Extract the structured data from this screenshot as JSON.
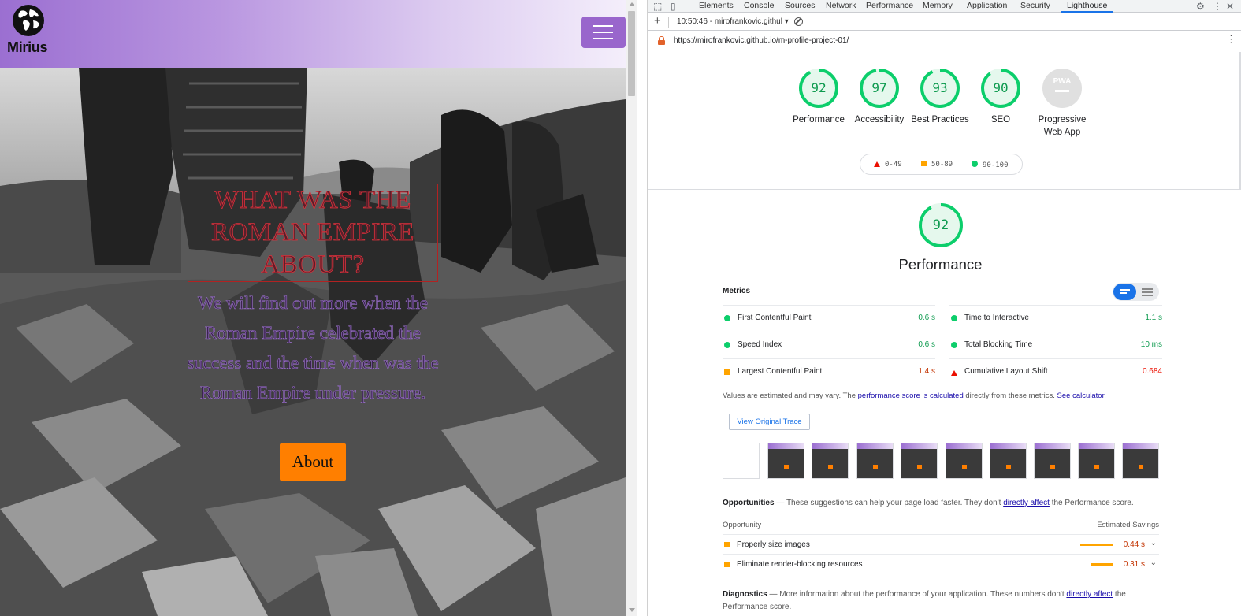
{
  "site": {
    "logo_text": "Mirius",
    "hero_title": "What was the Roman Empire about?",
    "hero_subtitle": "We will find out more when the Roman Empire celebrated the success and the time when was the Roman Empire under pressure.",
    "about_button": "About",
    "colors": {
      "header_start": "#9b6fd1",
      "burger": "#9966cc",
      "about": "#ff7f00",
      "title_stroke": "#d9323c"
    }
  },
  "devtools": {
    "tabs": [
      "Elements",
      "Console",
      "Sources",
      "Network",
      "Performance",
      "Memory",
      "Application",
      "Security",
      "Lighthouse"
    ],
    "active_tab": "Lighthouse",
    "report_select": "10:50:46 - mirofrankovic.githul ▾",
    "url": "https://mirofrankovic.github.io/m-profile-project-01/",
    "gauges": [
      {
        "score": "92",
        "label": "Performance",
        "value": 92
      },
      {
        "score": "97",
        "label": "Accessibility",
        "value": 97
      },
      {
        "score": "93",
        "label": "Best Practices",
        "value": 93
      },
      {
        "score": "90",
        "label": "SEO",
        "value": 90
      },
      {
        "score": "",
        "label": "Progressive Web App",
        "value": 0,
        "badge": "PWA"
      }
    ],
    "legend": {
      "fail": "0-49",
      "average": "50-89",
      "pass": "90-100"
    },
    "perf_score": "92",
    "perf_value": 92,
    "perf_title": "Performance",
    "metrics_title": "Metrics",
    "metrics": [
      {
        "name": "First Contentful Paint",
        "value": "0.6 s",
        "status": "pass"
      },
      {
        "name": "Time to Interactive",
        "value": "1.1 s",
        "status": "pass"
      },
      {
        "name": "Speed Index",
        "value": "0.6 s",
        "status": "pass"
      },
      {
        "name": "Total Blocking Time",
        "value": "10 ms",
        "status": "pass"
      },
      {
        "name": "Largest Contentful Paint",
        "value": "1.4 s",
        "status": "average"
      },
      {
        "name": "Cumulative Layout Shift",
        "value": "0.684",
        "status": "fail"
      }
    ],
    "note": {
      "prefix": "Values are estimated and may vary. The ",
      "link1": "performance score is calculated",
      "middle": " directly from these metrics. ",
      "link2": "See calculator."
    },
    "view_trace": "View Original Trace",
    "opportunities": {
      "title": "Opportunities",
      "desc_prefix": " — These suggestions can help your page load faster. They don't ",
      "desc_link": "directly affect",
      "desc_suffix": " the Performance score.",
      "col_opportunity": "Opportunity",
      "col_savings": "Estimated Savings",
      "items": [
        {
          "name": "Properly size images",
          "savings": "0.44 s",
          "bar_fraction": 0.44
        },
        {
          "name": "Eliminate render-blocking resources",
          "savings": "0.31 s",
          "bar_fraction": 0.31
        }
      ]
    },
    "diagnostics": {
      "title": "Diagnostics",
      "desc_prefix": " — More information about the performance of your application. These numbers don't ",
      "desc_link": "directly affect",
      "desc_suffix": " the Performance score."
    },
    "colors": {
      "pass": "#0cce6b",
      "average": "#ffa400",
      "fail": "#eb0f00",
      "accent": "#1a73e8"
    }
  }
}
